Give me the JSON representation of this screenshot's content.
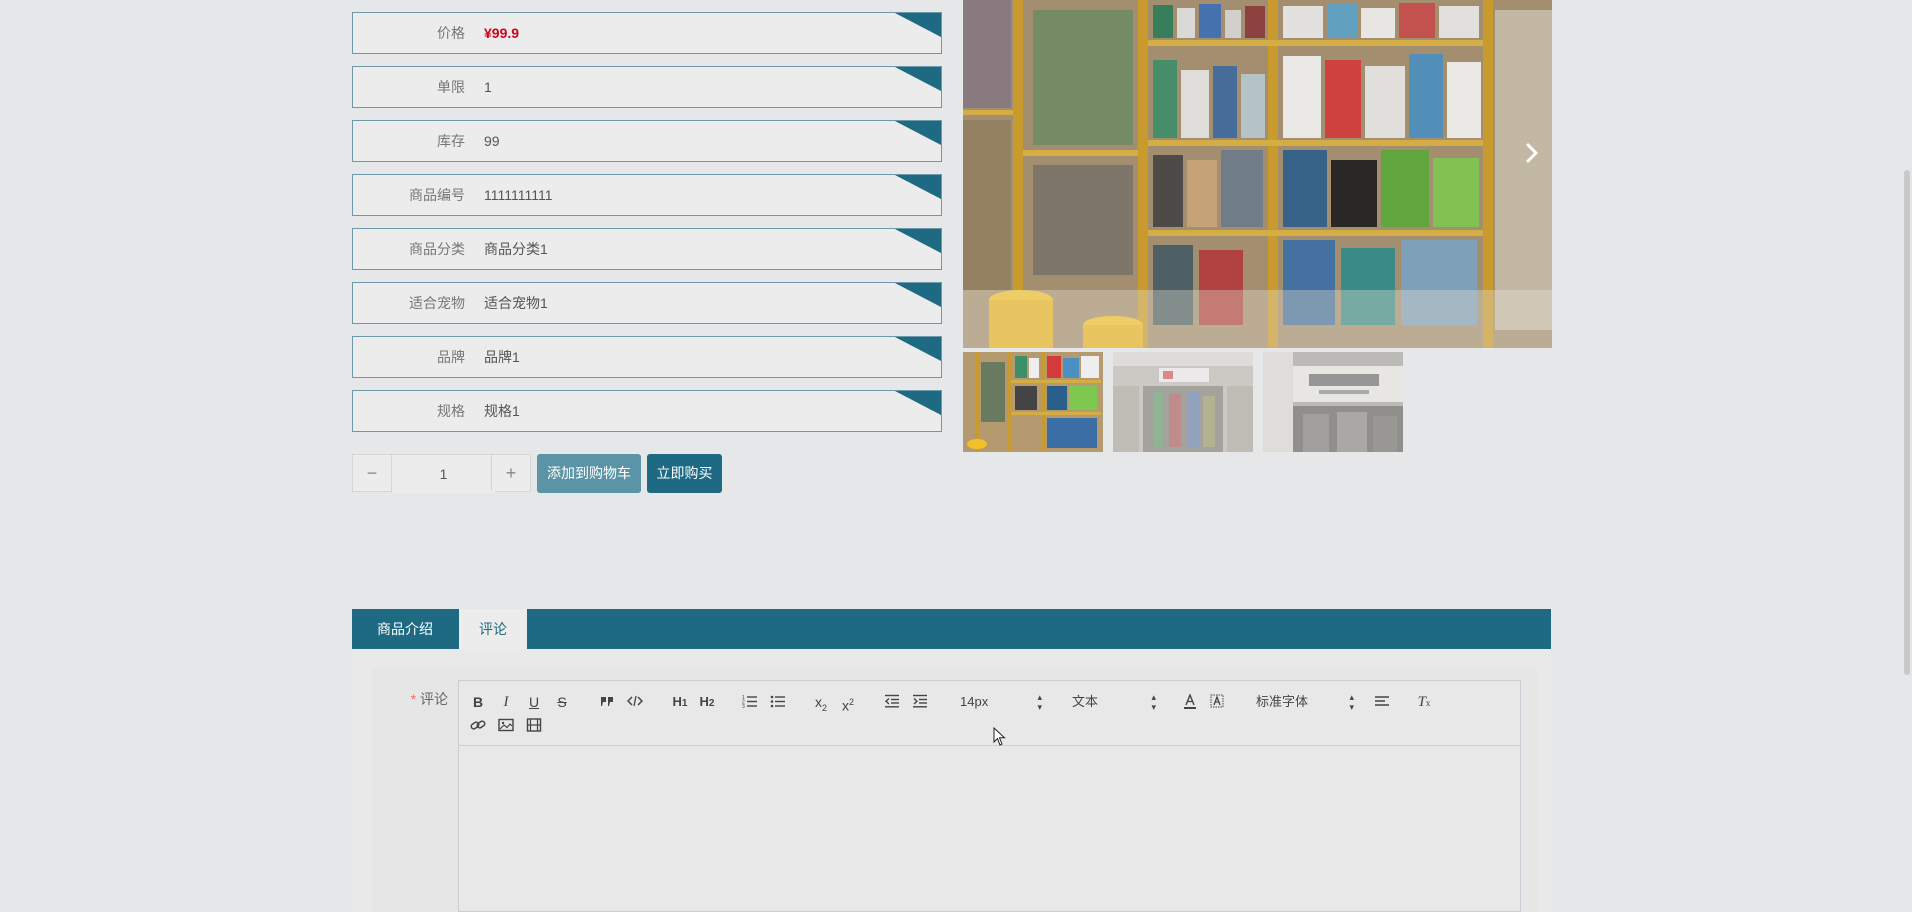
{
  "product": {
    "rows": [
      {
        "label": "价格",
        "value": "¥99.9"
      },
      {
        "label": "单限",
        "value": "1"
      },
      {
        "label": "库存",
        "value": "99"
      },
      {
        "label": "商品编号",
        "value": "1111111111"
      },
      {
        "label": "商品分类",
        "value": "商品分类1"
      },
      {
        "label": "适合宠物",
        "value": "适合宠物1"
      },
      {
        "label": "品牌",
        "value": "品牌1"
      },
      {
        "label": "规格",
        "value": "规格1"
      }
    ],
    "quantity": "1",
    "minus_symbol": "−",
    "plus_symbol": "+",
    "add_to_cart_label": "添加到购物车",
    "buy_now_label": "立即购买"
  },
  "gallery": {
    "next_arrow": "›",
    "active_thumb_index": 0,
    "thumb_count": 3
  },
  "tabs": [
    {
      "label": "商品介绍",
      "active": false
    },
    {
      "label": "评论",
      "active": true
    }
  ],
  "comment_form": {
    "required_mark": "*",
    "label": "评论",
    "font_size_value": "14px",
    "block_type_value": "文本",
    "font_family_value": "标准字体"
  },
  "colors": {
    "primary": "#1d6a82",
    "secondary_button": "#5a94a6",
    "price": "#d0021b",
    "background": "#e6e7e8"
  }
}
